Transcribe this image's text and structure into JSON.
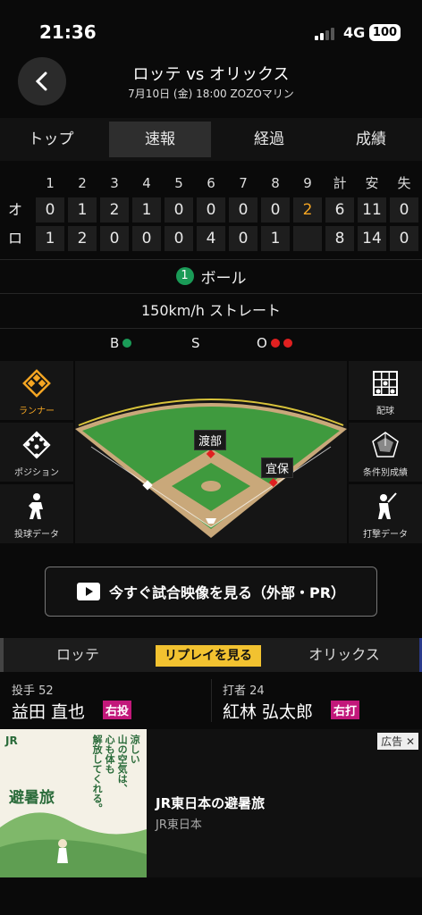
{
  "status": {
    "time": "21:36",
    "network": "4G",
    "battery": "100"
  },
  "header": {
    "title": "ロッテ vs オリックス",
    "subtitle": "7月10日 (金) 18:00 ZOZOマリン"
  },
  "tabs": [
    "トップ",
    "速報",
    "経過",
    "成績"
  ],
  "scoreboard": {
    "headers": [
      "1",
      "2",
      "3",
      "4",
      "5",
      "6",
      "7",
      "8",
      "9",
      "計",
      "安",
      "失"
    ],
    "rows": [
      {
        "team": "オ",
        "cells": [
          "0",
          "1",
          "2",
          "1",
          "0",
          "0",
          "0",
          "0",
          "2",
          "6",
          "11",
          "0"
        ]
      },
      {
        "team": "ロ",
        "cells": [
          "1",
          "2",
          "0",
          "0",
          "0",
          "4",
          "0",
          "1",
          "",
          "8",
          "14",
          "0"
        ]
      }
    ]
  },
  "ball": {
    "count": "1",
    "label": "ボール"
  },
  "pitch": "150km/h ストレート",
  "bso": {
    "b": "B",
    "s": "S",
    "o": "O"
  },
  "side_left": [
    "ランナー",
    "ポジション",
    "投球データ"
  ],
  "side_right": [
    "配球",
    "条件別成績",
    "打撃データ"
  ],
  "fielders": {
    "ss": "渡部",
    "first": "宜保"
  },
  "video_button": "今すぐ試合映像を見る（外部・PR）",
  "team_bar": {
    "left": "ロッテ",
    "replay": "リプレイを見る",
    "right": "オリックス"
  },
  "pitcher": {
    "role": "投手 52",
    "name": "益田 直也",
    "hand": "右投"
  },
  "batter": {
    "role": "打者 24",
    "name": "紅林 弘太郎",
    "hand": "右打"
  },
  "ad": {
    "tag": "広告",
    "title": "JR東日本の避暑旅",
    "sponsor": "JR東日本",
    "img_text": "避暑旅",
    "img_copy": [
      "涼しい",
      "山の空気は、",
      "心も体も",
      "解放してくれる。"
    ],
    "logo": "JR"
  },
  "colors": {
    "accent": "#f5a623",
    "ball_green": "#1a9b57",
    "out_red": "#e02020",
    "badge": "#c2187a",
    "replay": "#f2c230"
  }
}
